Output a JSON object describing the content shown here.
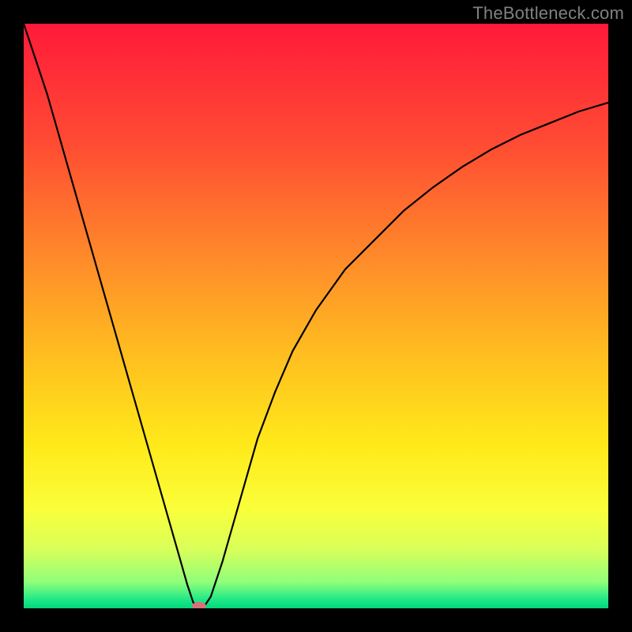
{
  "watermark": "TheBottleneck.com",
  "chart_data": {
    "type": "line",
    "title": "",
    "xlabel": "",
    "ylabel": "",
    "xlim": [
      0,
      100
    ],
    "ylim": [
      0,
      100
    ],
    "grid": false,
    "legend": false,
    "background": {
      "type": "vertical-gradient",
      "stops": [
        {
          "pos": 0.0,
          "color": "#ff1a3a"
        },
        {
          "pos": 0.2,
          "color": "#ff4a33"
        },
        {
          "pos": 0.4,
          "color": "#ff8a2a"
        },
        {
          "pos": 0.58,
          "color": "#ffc21f"
        },
        {
          "pos": 0.72,
          "color": "#ffe91a"
        },
        {
          "pos": 0.83,
          "color": "#faff3a"
        },
        {
          "pos": 0.9,
          "color": "#d8ff5a"
        },
        {
          "pos": 0.955,
          "color": "#90ff7a"
        },
        {
          "pos": 0.985,
          "color": "#20e888"
        },
        {
          "pos": 1.0,
          "color": "#00d87a"
        }
      ]
    },
    "series": [
      {
        "name": "bottleneck-curve",
        "color": "#000000",
        "x": [
          0,
          2,
          4,
          6,
          8,
          10,
          12,
          14,
          16,
          18,
          20,
          22,
          24,
          26,
          28,
          29,
          30,
          30.5,
          31,
          32,
          34,
          36,
          38,
          40,
          43,
          46,
          50,
          55,
          60,
          65,
          70,
          75,
          80,
          85,
          90,
          95,
          100
        ],
        "y": [
          100,
          94,
          88,
          81,
          74,
          67,
          60,
          53,
          46,
          39,
          32,
          25,
          18,
          11,
          4,
          1,
          0,
          0,
          0.5,
          2,
          8,
          15,
          22,
          29,
          37,
          44,
          51,
          58,
          63,
          68,
          72,
          75.5,
          78.5,
          81,
          83,
          85,
          86.5
        ]
      }
    ],
    "marker": {
      "name": "bottleneck-marker",
      "x": 30,
      "y": 0,
      "color": "#d9707a",
      "rx": 9,
      "ry": 5
    }
  }
}
